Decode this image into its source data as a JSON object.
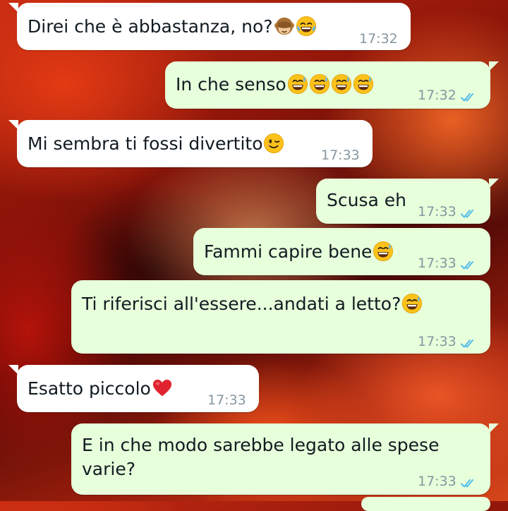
{
  "chat": {
    "messages": [
      {
        "direction": "in",
        "text": "Direi che è abbastanza, no?",
        "emojis": [
          "see-no-evil-monkey",
          "joy"
        ],
        "time": "17:32"
      },
      {
        "direction": "out",
        "text": "In che senso",
        "emojis": [
          "sweat-smile",
          "sweat-smile",
          "sweat-smile",
          "sweat-smile"
        ],
        "time": "17:32",
        "status": "read"
      },
      {
        "direction": "in",
        "text": "Mi sembra ti fossi divertito",
        "emojis": [
          "wink"
        ],
        "time": "17:33"
      },
      {
        "direction": "out",
        "text": "Scusa eh",
        "emojis": [],
        "time": "17:33",
        "status": "read"
      },
      {
        "direction": "out",
        "text": "Fammi capire bene",
        "emojis": [
          "sweat-smile"
        ],
        "time": "17:33",
        "status": "read"
      },
      {
        "direction": "out",
        "text": "Ti riferisci all'essere...andati a letto?",
        "emojis": [
          "sweat-smile"
        ],
        "time": "17:33",
        "status": "read"
      },
      {
        "direction": "in",
        "text": "Esatto piccolo",
        "emojis": [
          "red-heart"
        ],
        "time": "17:33"
      },
      {
        "direction": "out",
        "line1": "E in che modo sarebbe legato alle spese",
        "line2": "varie?",
        "emojis": [],
        "time": "17:33",
        "status": "read"
      }
    ]
  },
  "colors": {
    "incoming_bubble": "#ffffff",
    "outgoing_bubble": "#e7ffdb",
    "text": "#111b21",
    "timestamp": "#8696a0",
    "read_ticks": "#53bdeb"
  }
}
